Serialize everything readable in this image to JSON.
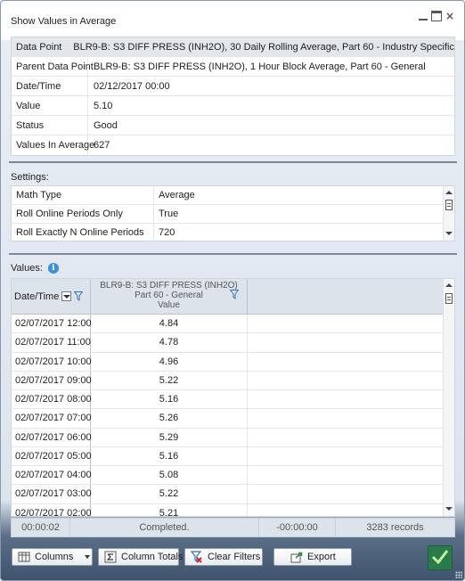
{
  "window": {
    "title": "Show Values in Average"
  },
  "info": [
    {
      "label": "Data Point",
      "value": "BLR9-B: S3 DIFF PRESS (INH2O), 30 Daily Rolling Average, Part 60 - Industry Specific"
    },
    {
      "label": "Parent Data Point",
      "value": "BLR9-B: S3 DIFF PRESS (INH2O), 1 Hour Block Average, Part 60 - General"
    },
    {
      "label": "Date/Time",
      "value": "02/12/2017 00:00"
    },
    {
      "label": "Value",
      "value": "5.10"
    },
    {
      "label": "Status",
      "value": "Good"
    },
    {
      "label": "Values In Average",
      "value": "627"
    }
  ],
  "settings": {
    "label": "Settings:",
    "rows": [
      {
        "label": "Math Type",
        "value": "Average"
      },
      {
        "label": "Roll Online Periods Only",
        "value": "True"
      },
      {
        "label": "Roll Exactly N Online Periods",
        "value": "720"
      }
    ]
  },
  "values": {
    "label": "Values:",
    "header": {
      "date": "Date/Time",
      "value_line1": "BLR9-B: S3 DIFF PRESS (INH2O)",
      "value_line2": "Part 60 - General",
      "value_line3": "Value"
    },
    "rows": [
      {
        "date": "02/07/2017 12:00",
        "value": "4.84"
      },
      {
        "date": "02/07/2017 11:00",
        "value": "4.78"
      },
      {
        "date": "02/07/2017 10:00",
        "value": "4.96"
      },
      {
        "date": "02/07/2017 09:00",
        "value": "5.22"
      },
      {
        "date": "02/07/2017 08:00",
        "value": "5.16"
      },
      {
        "date": "02/07/2017 07:00",
        "value": "5.26"
      },
      {
        "date": "02/07/2017 06:00",
        "value": "5.29"
      },
      {
        "date": "02/07/2017 05:00",
        "value": "5.16"
      },
      {
        "date": "02/07/2017 04:00",
        "value": "5.08"
      },
      {
        "date": "02/07/2017 03:00",
        "value": "5.22"
      },
      {
        "date": "02/07/2017 02:00",
        "value": "5.21"
      }
    ]
  },
  "status_bar": {
    "elapsed": "00:00:02",
    "state": "Completed.",
    "remaining": "-00:00:00",
    "records": "3283 records"
  },
  "toolbar": {
    "columns": "Columns",
    "column_totals": "Column Totals",
    "clear_filters": "Clear Filters",
    "export": "Export"
  },
  "colors": {
    "ok_green": "#2a7a4b",
    "accent_blue": "#3d8fd8"
  }
}
